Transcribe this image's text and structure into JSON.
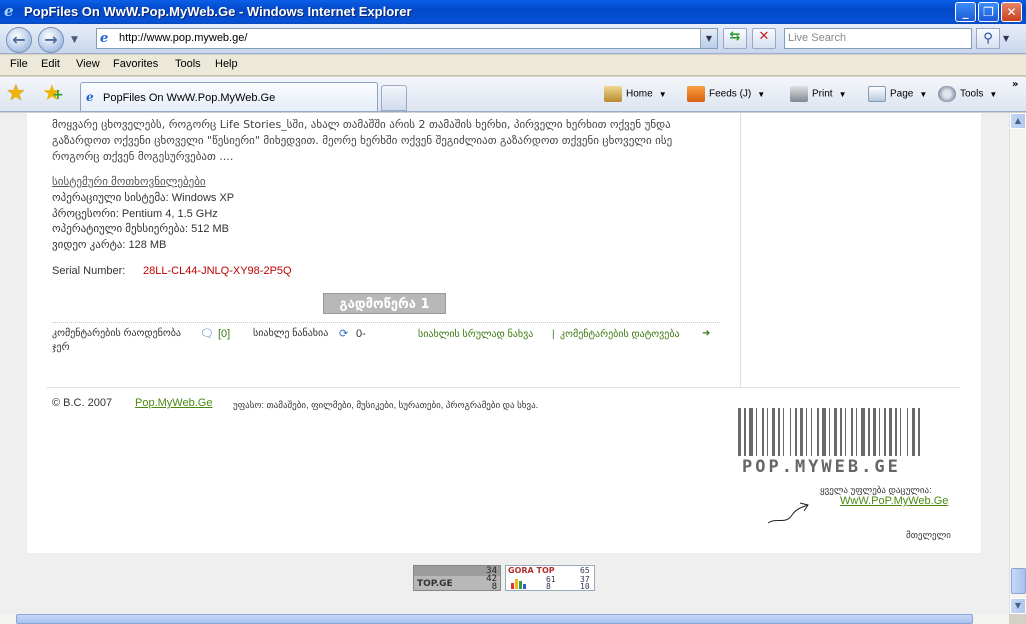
{
  "window": {
    "title": "PopFiles On WwW.Pop.MyWeb.Ge - Windows Internet Explorer",
    "controls": {
      "minimize": "_",
      "maximize": "❐",
      "close": "✕"
    }
  },
  "address_bar": {
    "url": "http://www.pop.myweb.ge/",
    "search_placeholder": "Live Search"
  },
  "menu": [
    "File",
    "Edit",
    "View",
    "Favorites",
    "Tools",
    "Help"
  ],
  "tabs": [
    {
      "label": "PopFiles On WwW.Pop.MyWeb.Ge"
    }
  ],
  "command_bar": {
    "home": "Home",
    "feeds": "Feeds (J)",
    "print": "Print",
    "page": "Page",
    "tools": "Tools"
  },
  "content": {
    "description": "მოყვარე ცხოველებს, როგორც Life Stories_სში, ახალ თამაშში არის 2 თამაშის ხერხი, პირველი ხერხით ოქვენ უნდა გაზარდოთ ოქვენი ცხოველი \"წესიერი\" მიხედვით. მეორე ხერხში ოქვენ შეგიძლიათ გაზარდოთ თქვენი ცხოველი ისე როგორც თქვენ მოგესურვებათ ....",
    "requirements_heading": "სისტემური მოთხოვნილებები",
    "requirements": [
      "ოპერაციული სისტემა: Windows XP",
      "პროცესორი: Pentium 4, 1.5 GHz",
      "ოპერატიული მეხსიერება: 512 MB",
      "ვიდეო კარტა: 128 MB"
    ],
    "serial_label": "Serial Number:",
    "serial_value": "28LL-CL44-JNLQ-XY98-2P5Q",
    "download_label": "გადმოწერა 1",
    "comments_label": "კომენტარების რაოდენობა",
    "comments_count": "[0]",
    "news_label": "სიახლე ნანახია",
    "views_count": "0-",
    "views_suffix": "ჯერ",
    "full_news_link": "სიახლის სრულად ნახვა",
    "separator": "|",
    "add_comment_link": "კომენტარების დატოვება"
  },
  "footer": {
    "copyright": "© B.C.   2007",
    "site_link": "Pop.MyWeb.Ge",
    "tagline": "უფასო: თამაშები, ფილმები, მუსიკები, სურათები, პროგრამები და სხვა.",
    "logo_text": "POP.MYWEB.GE",
    "all_free_label": "ყველა უფლება დაცულია:",
    "all_free_link": "WwW.PoP.MyWeb.Ge",
    "bottom_word": "მთელელი"
  },
  "counters": {
    "topge": {
      "logo": "TOP.GE",
      "values": [
        "34",
        "42",
        "8"
      ]
    },
    "goratop": {
      "logo": "GORA TOP",
      "values": [
        "65",
        "61",
        "37",
        "8",
        "10"
      ]
    }
  },
  "colors": {
    "accent_green": "#4a8a10",
    "serial_red": "#c00000",
    "titlebar_blue": "#0348c8"
  }
}
